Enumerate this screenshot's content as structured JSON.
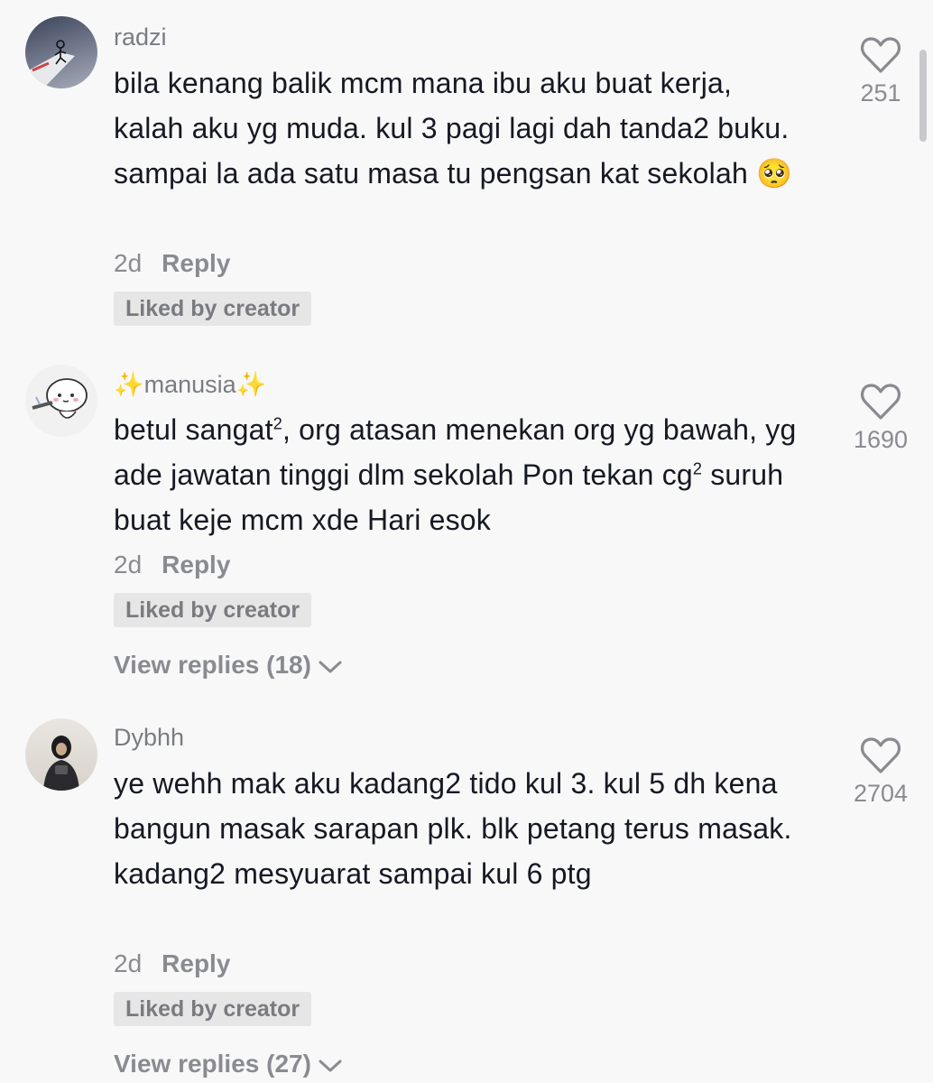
{
  "comments": [
    {
      "username": "radzi",
      "text": "bila kenang balik mcm mana ibu aku buat kerja, kalah aku yg muda. kul 3 pagi lagi dah tanda2 buku. sampai la ada satu masa tu pengsan kat sekolah 🥺",
      "time": "2d",
      "reply": "Reply",
      "badge": "Liked by creator",
      "likes": "251"
    },
    {
      "username": "✨manusia✨",
      "text_part1": "betul sangat",
      "text_sup1": "2",
      "text_part2": ", org atasan menekan org yg bawah, yg ade jawatan tinggi dlm sekolah Pon tekan cg",
      "text_sup2": "2",
      "text_part3": " suruh buat keje mcm xde Hari esok",
      "time": "2d",
      "reply": "Reply",
      "badge": "Liked by creator",
      "view_replies": "View replies (18)",
      "likes": "1690"
    },
    {
      "username": "Dybhh",
      "text": "ye wehh mak aku kadang2 tido kul 3. kul 5 dh kena bangun masak sarapan plk. blk petang terus masak. kadang2 mesyuarat sampai kul 6 ptg",
      "time": "2d",
      "reply": "Reply",
      "badge": "Liked by creator",
      "view_replies": "View replies (27)",
      "likes": "2704"
    }
  ],
  "icons": {
    "like": "heart-outline-icon",
    "expand": "chevron-down-icon"
  },
  "colors": {
    "background": "#f8f8f8",
    "text": "#161823",
    "muted": "#8a8b91",
    "badge_bg": "#e6e6e7"
  }
}
